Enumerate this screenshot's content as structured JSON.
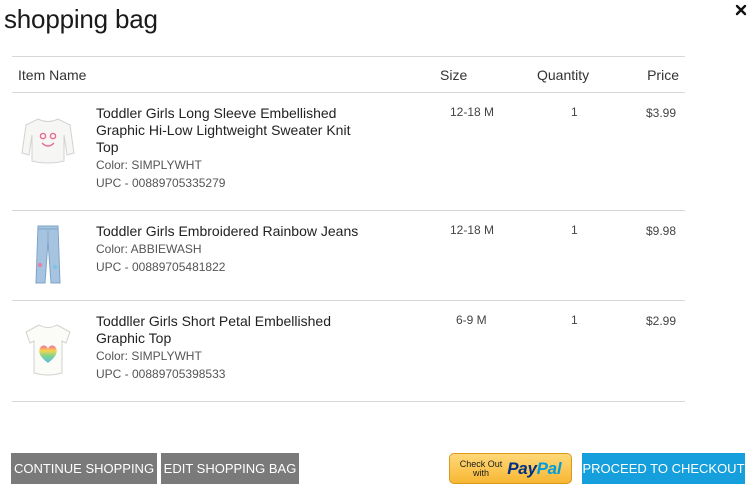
{
  "modal": {
    "title": "shopping bag"
  },
  "table": {
    "headers": {
      "item_name": "Item Name",
      "size": "Size",
      "quantity": "Quantity",
      "price": "Price"
    },
    "items": [
      {
        "name": "Toddler Girls Long Sleeve Embellished Graphic Hi-Low Lightweight Sweater Knit Top",
        "color_label": "Color: SIMPLYWHT",
        "upc_label": "UPC  - 00889705335279",
        "size": "12-18 M",
        "quantity": "1",
        "price": "$3.99"
      },
      {
        "name": "Toddler Girls Embroidered Rainbow Jeans",
        "color_label": "Color: ABBIEWASH",
        "upc_label": "UPC  - 00889705481822",
        "size": "12-18 M",
        "quantity": "1",
        "price": "$9.98"
      },
      {
        "name": "Toddller Girls Short Petal Embellished Graphic Top",
        "color_label": "Color: SIMPLYWHT",
        "upc_label": "UPC  - 00889705398533",
        "size": "6-9 M",
        "quantity": "1",
        "price": "$2.99"
      }
    ]
  },
  "actions": {
    "continue_label": "CONTINUE SHOPPING",
    "edit_label": "EDIT SHOPPING BAG",
    "paypal_prefix_line1": "Check Out",
    "paypal_prefix_line2": "with",
    "paypal_logo_part1": "Pay",
    "paypal_logo_part2": "Pal",
    "checkout_label": "PROCEED TO CHECKOUT"
  },
  "colors": {
    "checkout_blue": "#159fdd",
    "secondary_gray": "#7a7a7a",
    "paypal_gold": "#f7b733",
    "divider": "#d8d8d8"
  },
  "icons": {
    "close": "close-icon",
    "item1": "sweater-top-icon",
    "item2": "jeans-icon",
    "item3": "rainbow-heart-tee-icon"
  }
}
